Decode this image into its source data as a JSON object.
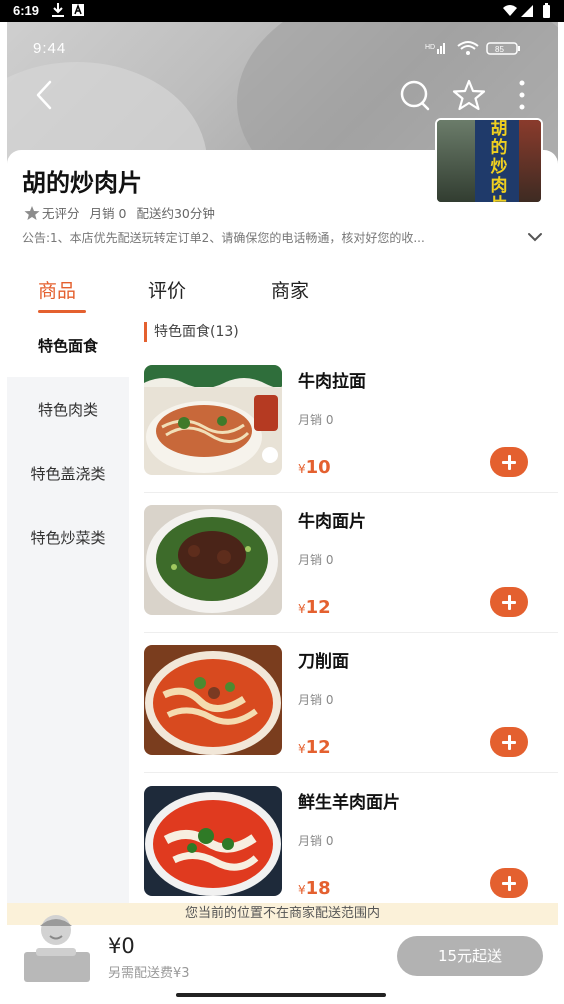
{
  "system_status": {
    "time": "6:19"
  },
  "header": {
    "inner_time": "9:44",
    "battery": "85"
  },
  "shop": {
    "name": "胡的炒肉片",
    "photo_sign": [
      "胡",
      "的",
      "炒",
      "肉",
      "片"
    ],
    "rating": "无评分",
    "monthly_sales": "月销 0",
    "delivery_time": "配送约30分钟",
    "notice": "公告:1、本店优先配送玩转定订单2、请确保您的电话畅通，核对好您的收..."
  },
  "tabs": [
    {
      "label": "商品"
    },
    {
      "label": "评价"
    },
    {
      "label": "商家"
    }
  ],
  "categories": [
    {
      "label": "特色面食"
    },
    {
      "label": "特色肉类"
    },
    {
      "label": "特色盖浇类"
    },
    {
      "label": "特色炒菜类"
    }
  ],
  "section": {
    "title": "特色面食(13)"
  },
  "products": [
    {
      "name": "牛肉拉面",
      "sales": "月销 0",
      "currency": "¥",
      "price": "10",
      "image": "beef-noodle-soup"
    },
    {
      "name": "牛肉面片",
      "sales": "月销 0",
      "currency": "¥",
      "price": "12",
      "image": "beef-noodle-slices"
    },
    {
      "name": "刀削面",
      "sales": "月销 0",
      "currency": "¥",
      "price": "12",
      "image": "knife-cut-noodles"
    },
    {
      "name": "鲜生羊肉面片",
      "sales": "月销 0",
      "currency": "¥",
      "price": "18",
      "image": "lamb-noodle-slices"
    }
  ],
  "bottom": {
    "range_notice": "您当前的位置不在商家配送范围内",
    "total": "¥0",
    "extra_fee": "另需配送费¥3",
    "min_order": "15元起送"
  },
  "colors": {
    "accent": "#e4602f",
    "sidebar_bg": "#f4f5f7",
    "notice_bg": "#fbf1d9",
    "disabled_btn": "#b2b2b2"
  }
}
